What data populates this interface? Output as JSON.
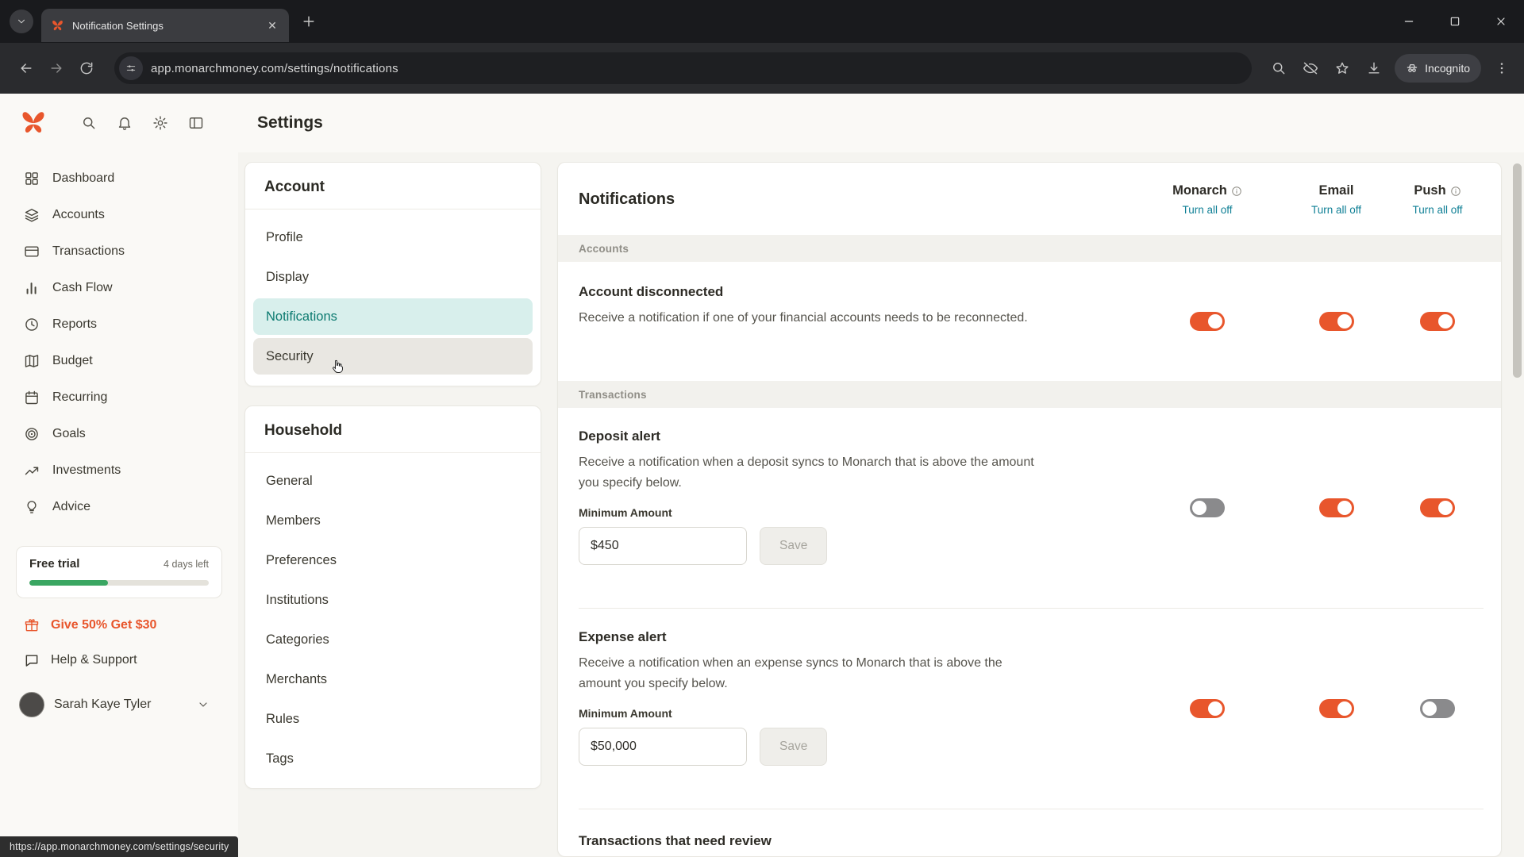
{
  "browser": {
    "tab_title": "Notification Settings",
    "url": "app.monarchmoney.com/settings/notifications",
    "incognito_label": "Incognito"
  },
  "app": {
    "header_title": "Settings"
  },
  "sidebar": {
    "items": [
      {
        "label": "Dashboard",
        "icon": "dashboard-icon"
      },
      {
        "label": "Accounts",
        "icon": "accounts-icon"
      },
      {
        "label": "Transactions",
        "icon": "transactions-icon"
      },
      {
        "label": "Cash Flow",
        "icon": "cash-flow-icon"
      },
      {
        "label": "Reports",
        "icon": "reports-icon"
      },
      {
        "label": "Budget",
        "icon": "budget-icon"
      },
      {
        "label": "Recurring",
        "icon": "recurring-icon"
      },
      {
        "label": "Goals",
        "icon": "goals-icon"
      },
      {
        "label": "Investments",
        "icon": "investments-icon"
      },
      {
        "label": "Advice",
        "icon": "advice-icon"
      }
    ],
    "trial": {
      "title": "Free trial",
      "remaining": "4 days left",
      "progress_pct": 44
    },
    "promo_label": "Give 50% Get $30",
    "help_label": "Help & Support",
    "user_name": "Sarah Kaye Tyler"
  },
  "status_url": "https://app.monarchmoney.com/settings/security",
  "nav": {
    "account": {
      "title": "Account",
      "selected": "Notifications",
      "items": [
        {
          "label": "Profile"
        },
        {
          "label": "Display"
        },
        {
          "label": "Notifications"
        },
        {
          "label": "Security"
        }
      ]
    },
    "household": {
      "title": "Household",
      "items": [
        {
          "label": "General"
        },
        {
          "label": "Members"
        },
        {
          "label": "Preferences"
        },
        {
          "label": "Institutions"
        },
        {
          "label": "Categories"
        },
        {
          "label": "Merchants"
        },
        {
          "label": "Rules"
        },
        {
          "label": "Tags"
        }
      ]
    }
  },
  "main": {
    "title": "Notifications",
    "columns": [
      {
        "label": "Monarch",
        "has_info": true,
        "action": "Turn all off"
      },
      {
        "label": "Email",
        "has_info": false,
        "action": "Turn all off"
      },
      {
        "label": "Push",
        "has_info": true,
        "action": "Turn all off"
      }
    ],
    "sections": [
      {
        "name": "Accounts",
        "rows": [
          {
            "title": "Account disconnected",
            "description": "Receive a notification if one of your financial accounts needs to be reconnected.",
            "toggles": [
              true,
              true,
              true
            ]
          }
        ]
      },
      {
        "name": "Transactions",
        "rows": [
          {
            "title": "Deposit alert",
            "description": "Receive a notification when a deposit syncs to Monarch that is above the amount you specify below.",
            "min_amount_label": "Minimum Amount",
            "amount_value": "$450",
            "save_label": "Save",
            "toggles": [
              false,
              true,
              true
            ]
          },
          {
            "title": "Expense alert",
            "description": "Receive a notification when an expense syncs to Monarch that is above the amount you specify below.",
            "min_amount_label": "Minimum Amount",
            "amount_value": "$50,000",
            "save_label": "Save",
            "toggles": [
              true,
              true,
              false
            ]
          },
          {
            "title": "Transactions that need review"
          }
        ]
      }
    ]
  }
}
